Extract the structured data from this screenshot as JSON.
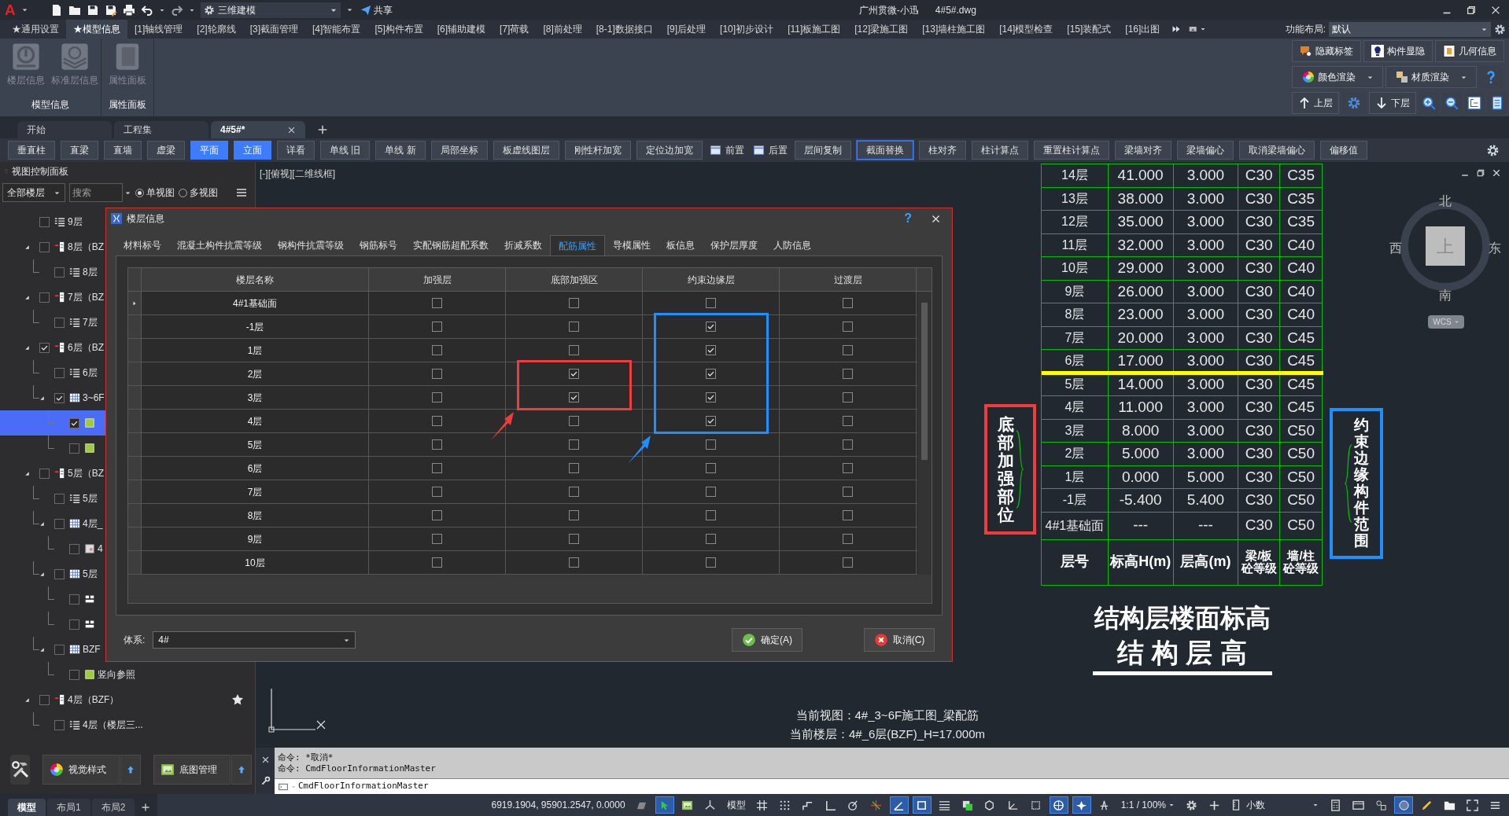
{
  "title_bar": {
    "logo": "A",
    "workspace": "三维建模",
    "share": "共享",
    "app_title": "广州贯微-小迅",
    "file_name": "4#5#.dwg"
  },
  "menu_tabs": [
    {
      "label": "★通用设置",
      "selected": false
    },
    {
      "label": "★模型信息",
      "selected": true
    },
    {
      "label": "[1]轴线管理",
      "selected": false
    },
    {
      "label": "[2]轮廓线",
      "selected": false
    },
    {
      "label": "[3]截面管理",
      "selected": false
    },
    {
      "label": "[4]智能布置",
      "selected": false
    },
    {
      "label": "[5]构件布置",
      "selected": false
    },
    {
      "label": "[6]辅助建模",
      "selected": false
    },
    {
      "label": "[7]荷载",
      "selected": false
    },
    {
      "label": "[8]前处理",
      "selected": false
    },
    {
      "label": "[8-1]数据接口",
      "selected": false
    },
    {
      "label": "[9]后处理",
      "selected": false
    },
    {
      "label": "[10]初步设计",
      "selected": false
    },
    {
      "label": "[11]板施工图",
      "selected": false
    },
    {
      "label": "[12]梁施工图",
      "selected": false
    },
    {
      "label": "[13]墙柱施工图",
      "selected": false
    },
    {
      "label": "[14]模型检查",
      "selected": false
    },
    {
      "label": "[15]装配式",
      "selected": false
    },
    {
      "label": "[16]出图",
      "selected": false
    }
  ],
  "layout_setting": {
    "label": "功能布局:",
    "value": "默认"
  },
  "ribbon": {
    "groups": [
      {
        "title": "模型信息",
        "buttons": [
          {
            "label": "楼层信息",
            "kind": "floor",
            "disabled": true
          },
          {
            "label": "标准层信息",
            "kind": "layers",
            "disabled": true
          }
        ]
      },
      {
        "title": "属性面板",
        "buttons": [
          {
            "label": "属性面板",
            "kind": "panel",
            "disabled": true
          }
        ]
      }
    ],
    "quick_rows": [
      [
        {
          "label": "隐藏标签",
          "kind": "tag",
          "dropdown": false
        },
        {
          "label": "构件显隐",
          "kind": "bulb",
          "dropdown": false
        },
        {
          "label": "几何信息",
          "kind": "docinfo",
          "dropdown": false
        }
      ],
      [
        {
          "label": "颜色渲染",
          "kind": "colorwheel",
          "dropdown": true
        },
        {
          "label": "材质渲染",
          "kind": "squares",
          "dropdown": true
        },
        {
          "kind": "help",
          "dropdown": false
        }
      ],
      [
        {
          "label": "上层",
          "kind": "arrowup",
          "dropdown": false
        },
        {
          "kind": "gear",
          "dropdown": false
        },
        {
          "label": "下层",
          "kind": "arrowdown",
          "dropdown": false
        },
        {
          "kind": "zoomin",
          "dropdown": false
        },
        {
          "kind": "zoomout",
          "dropdown": false
        },
        {
          "kind": "treeview",
          "dropdown": false
        },
        {
          "kind": "page",
          "dropdown": false
        }
      ]
    ]
  },
  "doc_tabs": [
    {
      "label": "开始",
      "selected": false
    },
    {
      "label": "工程集",
      "selected": false
    },
    {
      "label": "4#5#*",
      "selected": true
    }
  ],
  "toolbar": [
    {
      "label": "垂直柱",
      "kind": "text",
      "active": false,
      "focused": false
    },
    {
      "label": "直梁",
      "kind": "text",
      "active": false,
      "focused": false
    },
    {
      "label": "直墙",
      "kind": "text",
      "active": false,
      "focused": false
    },
    {
      "label": "虚梁",
      "kind": "text",
      "active": false,
      "focused": false
    },
    {
      "label": "平面",
      "kind": "text",
      "active": true,
      "focused": false
    },
    {
      "label": "立面",
      "kind": "text",
      "active": true,
      "focused": false
    },
    {
      "label": "详看",
      "kind": "text",
      "active": false,
      "focused": false
    },
    {
      "label": "单线 旧",
      "kind": "text",
      "active": false,
      "focused": false
    },
    {
      "label": "单线 新",
      "kind": "text",
      "active": false,
      "focused": false
    },
    {
      "label": "局部坐标",
      "kind": "text",
      "active": false,
      "focused": false
    },
    {
      "label": "板虚线图层",
      "kind": "text",
      "active": false,
      "focused": false
    },
    {
      "label": "刚性杆加宽",
      "kind": "text",
      "active": false,
      "focused": false
    },
    {
      "label": "定位边加宽",
      "kind": "text",
      "active": false,
      "focused": false
    },
    {
      "label": "前置",
      "kind": "icon",
      "active": false,
      "focused": false
    },
    {
      "label": "后置",
      "kind": "icon",
      "active": false,
      "focused": false
    },
    {
      "label": "层间复制",
      "kind": "text",
      "active": false,
      "focused": false
    },
    {
      "label": "截面替换",
      "kind": "text",
      "active": false,
      "focused": true
    },
    {
      "label": "柱对齐",
      "kind": "text",
      "active": false,
      "focused": false
    },
    {
      "label": "柱计算点",
      "kind": "text",
      "active": false,
      "focused": false
    },
    {
      "label": "重置柱计算点",
      "kind": "text",
      "active": false,
      "focused": false
    },
    {
      "label": "梁墙对齐",
      "kind": "text",
      "active": false,
      "focused": false
    },
    {
      "label": "梁墙偏心",
      "kind": "text",
      "active": false,
      "focused": false
    },
    {
      "label": "取消梁墙偏心",
      "kind": "text",
      "active": false,
      "focused": false
    },
    {
      "label": "偏移值",
      "kind": "text",
      "active": false,
      "focused": false
    }
  ],
  "left_panel": {
    "title": "视图控制面板",
    "floor_filter": "全部楼层",
    "search_placeholder": "搜索",
    "view_modes": [
      {
        "label": "单视图",
        "selected": true
      },
      {
        "label": "多视图",
        "selected": false
      }
    ],
    "tree": [
      {
        "label": "9层",
        "kind": "list",
        "checked": false,
        "selected": false,
        "starred": false
      },
      {
        "label": "8层（BZ",
        "kind": "floor",
        "checked": false,
        "selected": false,
        "starred": false,
        "expanded": true,
        "children": [
          {
            "label": "8层",
            "kind": "list",
            "checked": false,
            "selected": false
          }
        ]
      },
      {
        "label": "7层（BZ",
        "kind": "floor",
        "checked": false,
        "selected": false,
        "starred": false,
        "expanded": true,
        "children": [
          {
            "label": "7层",
            "kind": "list",
            "checked": false,
            "selected": false
          }
        ]
      },
      {
        "label": "6层（BZ",
        "kind": "floor",
        "checked": true,
        "selected": false,
        "starred": false,
        "expanded": true,
        "children": [
          {
            "label": "6层",
            "kind": "list",
            "checked": false,
            "selected": false
          },
          {
            "label": "3~6F",
            "kind": "grid",
            "checked": true,
            "selected": false,
            "expanded": true,
            "children": [
              {
                "kind": "green",
                "checked": true,
                "selected": true
              },
              {
                "kind": "green",
                "checked": false,
                "selected": false
              }
            ]
          }
        ]
      },
      {
        "label": "5层（BZ",
        "kind": "floor",
        "checked": false,
        "selected": false,
        "starred": false,
        "expanded": true,
        "children": [
          {
            "label": "5层",
            "kind": "list",
            "checked": false,
            "selected": false
          },
          {
            "label": "4层_",
            "kind": "grid",
            "checked": false,
            "selected": false,
            "expanded": true,
            "children": [
              {
                "label": "4",
                "kind": "image",
                "checked": false,
                "selected": false
              }
            ]
          },
          {
            "label": "5层",
            "kind": "grid",
            "checked": false,
            "selected": false,
            "expanded": true,
            "children": [
              {
                "kind": "blocks",
                "checked": false,
                "selected": false
              },
              {
                "kind": "blocks",
                "checked": false,
                "selected": false
              }
            ]
          },
          {
            "label": "BZF",
            "kind": "grid",
            "checked": false,
            "selected": false,
            "expanded": true,
            "children": [
              {
                "label": "竖向参照",
                "kind": "green",
                "checked": false,
                "selected": false
              }
            ]
          }
        ]
      },
      {
        "label": "4层（BZF）",
        "kind": "floor",
        "checked": false,
        "selected": false,
        "starred": true,
        "expanded": true,
        "children": [
          {
            "label": "4层（楼层三...",
            "kind": "list",
            "checked": false,
            "selected": false
          }
        ]
      }
    ],
    "bottom_buttons": [
      {
        "label": "视觉样式",
        "kind": "colorwheel"
      },
      {
        "label": "底图管理",
        "kind": "picture"
      }
    ]
  },
  "dialog": {
    "title": "楼层信息",
    "help": "?",
    "tabs": [
      {
        "label": "材料标号",
        "selected": false
      },
      {
        "label": "混凝土构件抗震等级",
        "selected": false
      },
      {
        "label": "钢构件抗震等级",
        "selected": false
      },
      {
        "label": "钢筋标号",
        "selected": false
      },
      {
        "label": "实配钢筋超配系数",
        "selected": false
      },
      {
        "label": "折减系数",
        "selected": false
      },
      {
        "label": "配筋属性",
        "selected": true
      },
      {
        "label": "导模属性",
        "selected": false
      },
      {
        "label": "板信息",
        "selected": false
      },
      {
        "label": "保护层厚度",
        "selected": false
      },
      {
        "label": "人防信息",
        "selected": false
      }
    ],
    "columns": [
      "楼层名称",
      "加强层",
      "底部加强区",
      "约束边缘层",
      "过渡层"
    ],
    "rows": [
      {
        "name": "4#1基础面",
        "current": true,
        "flags": [
          false,
          false,
          false,
          false
        ]
      },
      {
        "name": "-1层",
        "current": false,
        "flags": [
          false,
          false,
          true,
          false
        ]
      },
      {
        "name": "1层",
        "current": false,
        "flags": [
          false,
          false,
          true,
          false
        ]
      },
      {
        "name": "2层",
        "current": false,
        "flags": [
          false,
          true,
          true,
          false
        ]
      },
      {
        "name": "3层",
        "current": false,
        "flags": [
          false,
          true,
          true,
          false
        ]
      },
      {
        "name": "4层",
        "current": false,
        "flags": [
          false,
          false,
          true,
          false
        ]
      },
      {
        "name": "5层",
        "current": false,
        "flags": [
          false,
          false,
          false,
          false
        ]
      },
      {
        "name": "6层",
        "current": false,
        "flags": [
          false,
          false,
          false,
          false
        ]
      },
      {
        "name": "7层",
        "current": false,
        "flags": [
          false,
          false,
          false,
          false
        ]
      },
      {
        "name": "8层",
        "current": false,
        "flags": [
          false,
          false,
          false,
          false
        ]
      },
      {
        "name": "9层",
        "current": false,
        "flags": [
          false,
          false,
          false,
          false
        ]
      },
      {
        "name": "10层",
        "current": false,
        "flags": [
          false,
          false,
          false,
          false
        ]
      }
    ],
    "highlights": [
      {
        "color": "#f03c3c"
      },
      {
        "color": "#1e8fff"
      }
    ],
    "system_label": "体系:",
    "system_value": "4#",
    "buttons": [
      {
        "label": "确定(A)",
        "kind": "ok"
      },
      {
        "label": "取消(C)",
        "kind": "cancel"
      }
    ]
  },
  "canvas": {
    "view_label": "[-][俯视][二维线框]",
    "floor_table": {
      "rows": [
        {
          "cells": [
            "14层",
            "41.000",
            "3.000",
            "C30",
            "C35"
          ],
          "highlight_below": false
        },
        {
          "cells": [
            "13层",
            "38.000",
            "3.000",
            "C30",
            "C35"
          ],
          "highlight_below": false
        },
        {
          "cells": [
            "12层",
            "35.000",
            "3.000",
            "C30",
            "C35"
          ],
          "highlight_below": false
        },
        {
          "cells": [
            "11层",
            "32.000",
            "3.000",
            "C30",
            "C40"
          ],
          "highlight_below": false
        },
        {
          "cells": [
            "10层",
            "29.000",
            "3.000",
            "C30",
            "C40"
          ],
          "highlight_below": false
        },
        {
          "cells": [
            "9层",
            "26.000",
            "3.000",
            "C30",
            "C40"
          ],
          "highlight_below": false
        },
        {
          "cells": [
            "8层",
            "23.000",
            "3.000",
            "C30",
            "C40"
          ],
          "highlight_below": false
        },
        {
          "cells": [
            "7层",
            "20.000",
            "3.000",
            "C30",
            "C45"
          ],
          "highlight_below": false
        },
        {
          "cells": [
            "6层",
            "17.000",
            "3.000",
            "C30",
            "C45"
          ],
          "highlight_below": true
        },
        {
          "cells": [
            "5层",
            "14.000",
            "3.000",
            "C30",
            "C45"
          ],
          "highlight_below": false
        },
        {
          "cells": [
            "4层",
            "11.000",
            "3.000",
            "C30",
            "C45"
          ],
          "highlight_below": false
        },
        {
          "cells": [
            "3层",
            "8.000",
            "3.000",
            "C30",
            "C50"
          ],
          "highlight_below": false
        },
        {
          "cells": [
            "2层",
            "5.000",
            "3.000",
            "C30",
            "C50"
          ],
          "highlight_below": false
        },
        {
          "cells": [
            "1层",
            "0.000",
            "5.000",
            "C30",
            "C50"
          ],
          "highlight_below": false
        },
        {
          "cells": [
            "-1层",
            "-5.400",
            "5.400",
            "C30",
            "C50"
          ],
          "highlight_below": false
        },
        {
          "cells": [
            "4#1基础面",
            "---",
            "---",
            "C30",
            "C50"
          ],
          "highlight_below": false
        }
      ],
      "header": [
        "层号",
        "标高H(m)",
        "层高(m)",
        "梁/板砼等级",
        "墙/柱砼等级"
      ],
      "title": "结构层楼面标高",
      "subtitle": "结 构 层 高"
    },
    "callouts": [
      {
        "text": "底部加强部位",
        "color": "#f03c3c"
      },
      {
        "text": "约束边缘构件范围",
        "color": "#1e8fff"
      }
    ],
    "compass": {
      "north": "北",
      "south": "南",
      "west": "西",
      "east": "东",
      "top": "上",
      "wcs": "WCS"
    },
    "current_view": "当前视图：4#_3~6F施工图_梁配筋",
    "current_floor": "当前楼层：4#_6层(BZF)_H=17.000m"
  },
  "command": {
    "history": [
      "命令: *取消*",
      "命令: CmdFloorInformationMaster"
    ],
    "input": "CmdFloorInformationMaster"
  },
  "status_bar": {
    "layout_tabs": [
      {
        "label": "模型",
        "selected": true
      },
      {
        "label": "布局1",
        "selected": false
      },
      {
        "label": "布局2",
        "selected": false
      }
    ],
    "coordinates": "6919.1904, 95901.2547, 0.0000",
    "toggles_a": [
      {
        "kind": "board",
        "on": false
      },
      {
        "kind": "cursor",
        "on": true
      },
      {
        "kind": "picture",
        "on": false
      },
      {
        "kind": "tripod",
        "on": false
      }
    ],
    "space": "模型",
    "toggles_b": [
      {
        "kind": "hash",
        "on": false
      },
      {
        "kind": "dots",
        "on": false
      },
      {
        "kind": "step",
        "on": false
      },
      {
        "kind": "ortho",
        "on": false
      },
      {
        "kind": "polar",
        "on": false
      },
      {
        "kind": "crosshair",
        "on": false
      },
      {
        "kind": "angle",
        "on": true
      },
      {
        "kind": "square",
        "on": true
      },
      {
        "kind": "lines",
        "on": false
      },
      {
        "kind": "layers2",
        "on": false
      },
      {
        "kind": "cubes",
        "on": false
      },
      {
        "kind": "axes",
        "on": false
      },
      {
        "kind": "box",
        "on": false
      },
      {
        "kind": "gizmo",
        "on": true
      },
      {
        "kind": "person",
        "on": true
      },
      {
        "kind": "anno",
        "on": false
      }
    ],
    "scale": "1:1 / 100%",
    "toggles_c": [
      {
        "kind": "gear",
        "on": false
      },
      {
        "kind": "plus",
        "on": false
      }
    ],
    "units": "小数",
    "toggles_d": [
      {
        "kind": "calc",
        "on": false
      },
      {
        "kind": "window",
        "on": false
      },
      {
        "kind": "shapes",
        "on": false
      },
      {
        "kind": "circle",
        "on": true
      },
      {
        "kind": "brush",
        "on": false
      },
      {
        "kind": "folder",
        "on": false
      },
      {
        "kind": "fullscreen",
        "on": false
      },
      {
        "kind": "menu",
        "on": false
      }
    ]
  }
}
